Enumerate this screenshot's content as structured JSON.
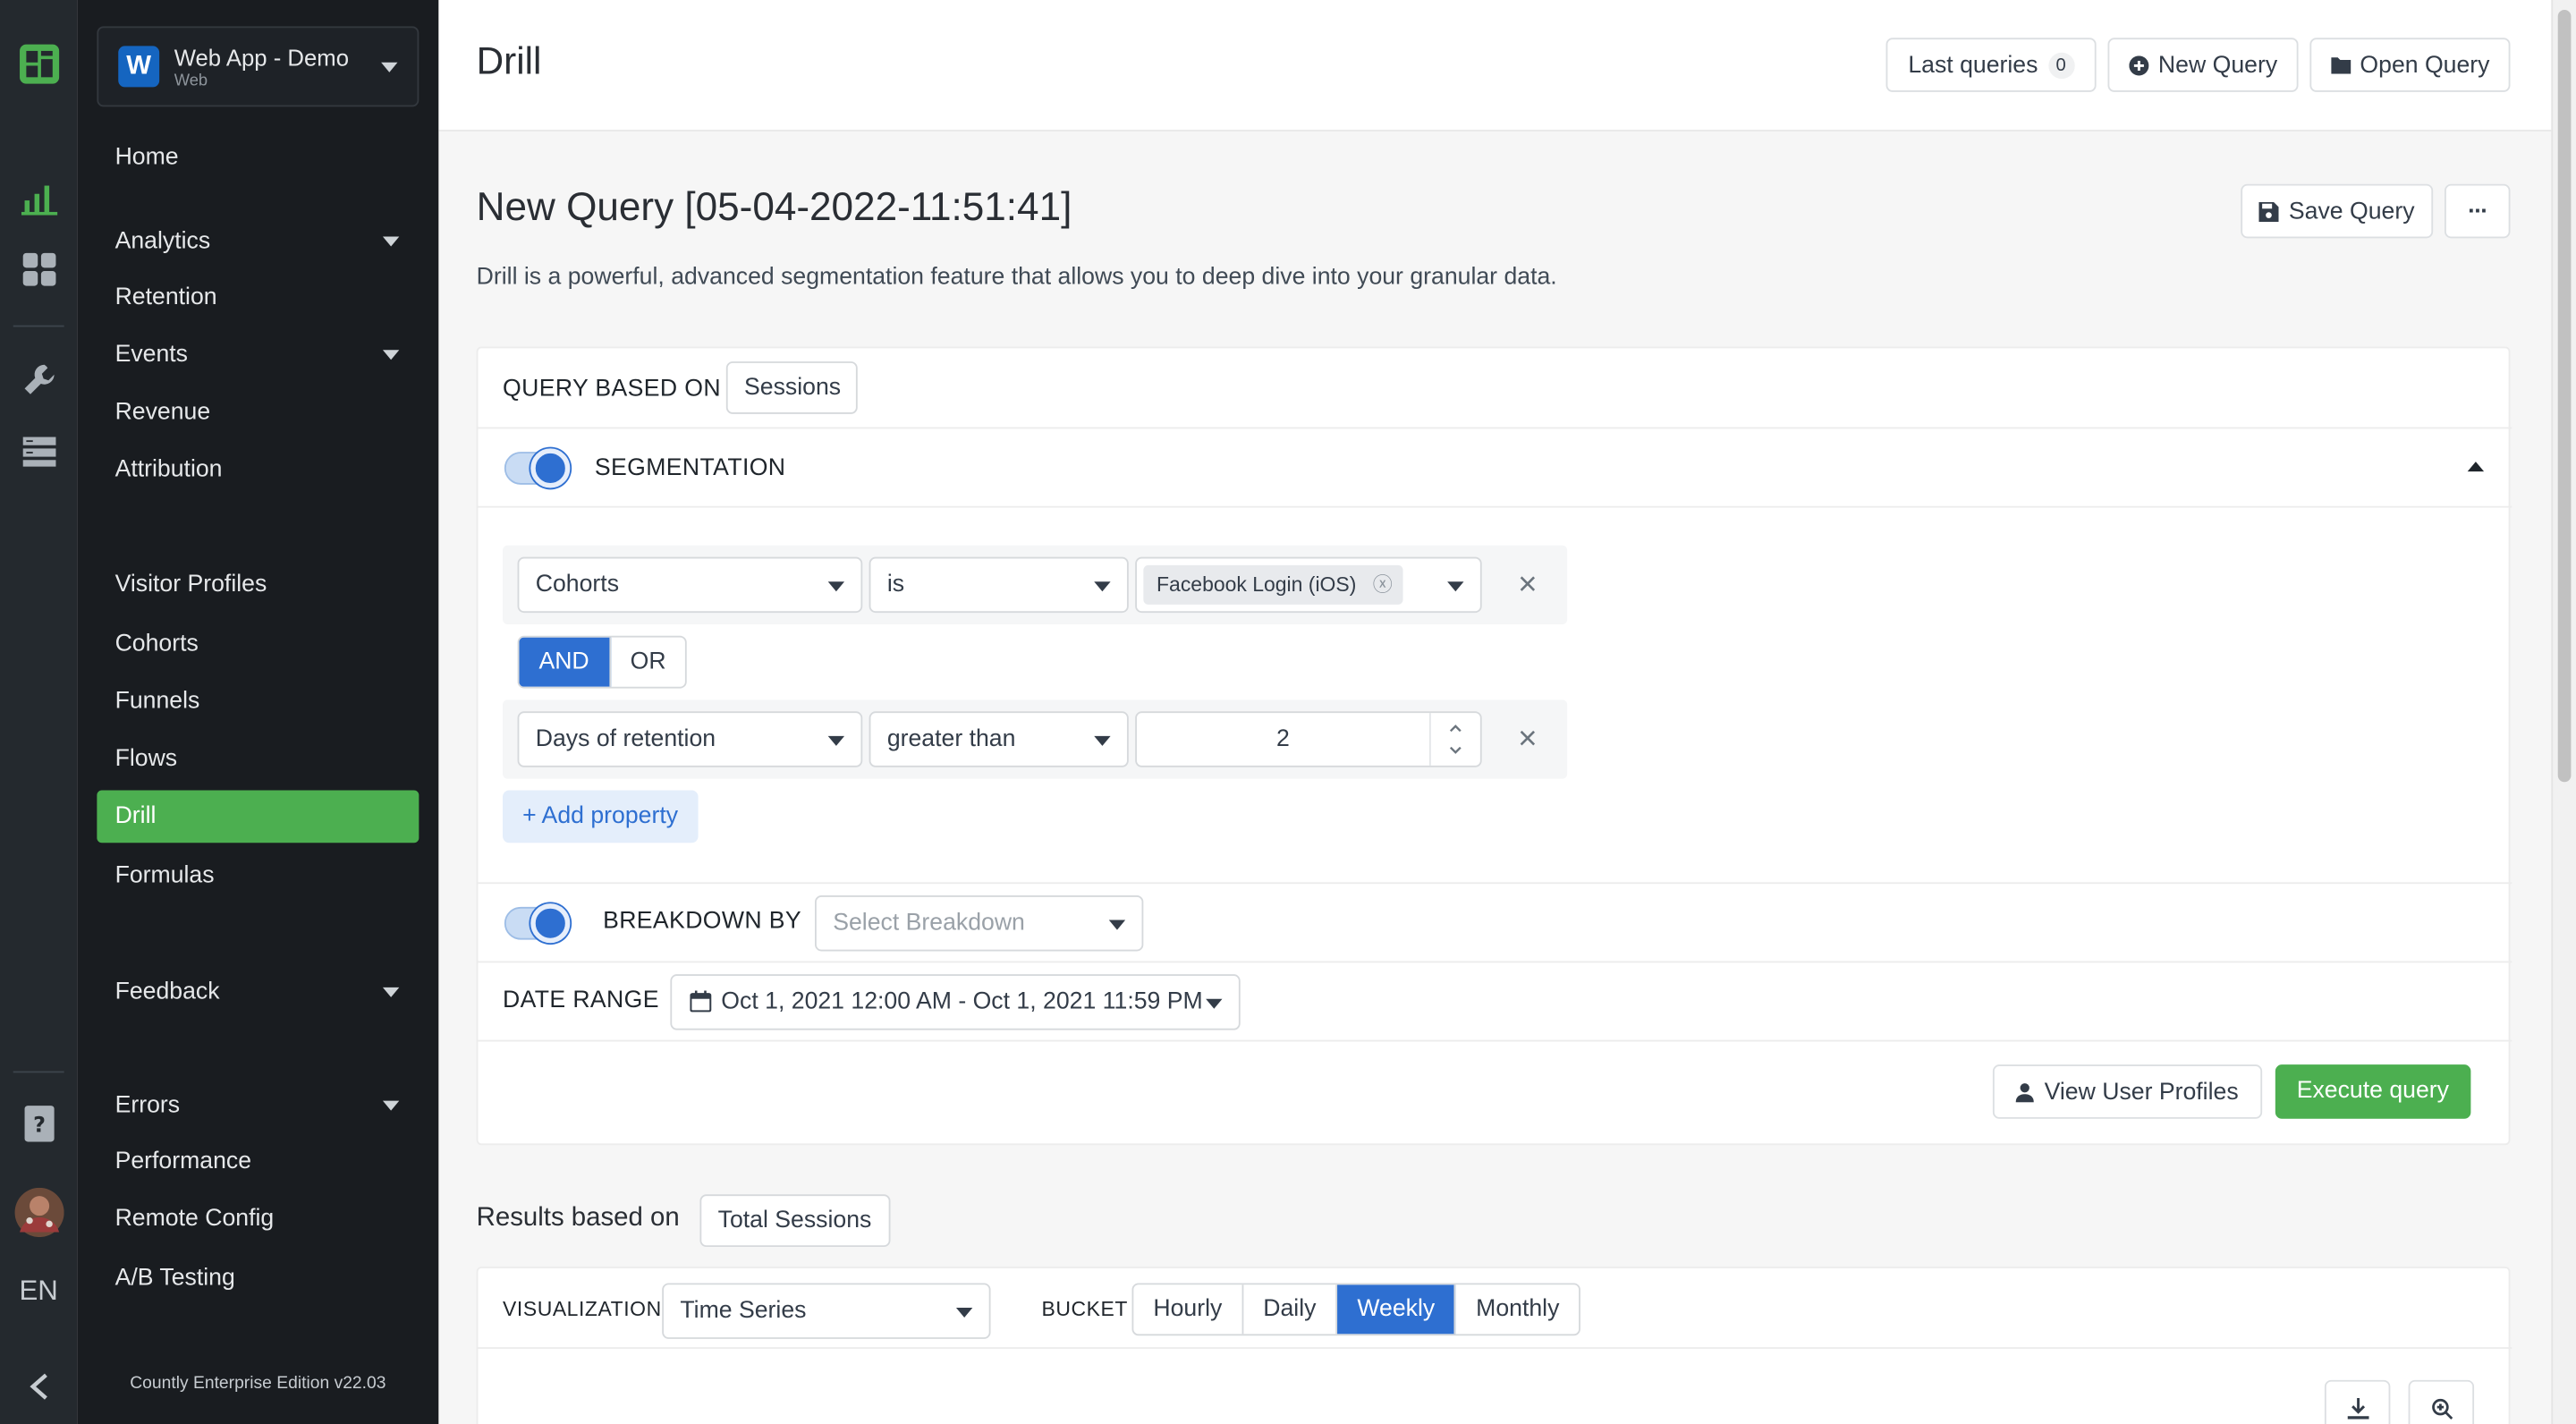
{
  "app": {
    "badge_letter": "W",
    "name": "Web App - Demo",
    "type": "Web",
    "language": "EN",
    "edition": "Countly Enterprise Edition v22.03"
  },
  "rail_icons": [
    "countly-logo-icon",
    "analytics-chart-icon",
    "dashboards-grid-icon",
    "management-wrench-icon",
    "data-storage-icon",
    "help-book-icon",
    "user-avatar",
    "collapse-chevron-left-icon"
  ],
  "sidebar": {
    "items": [
      {
        "label": "Home"
      },
      {
        "label": "Analytics",
        "expandable": true
      },
      {
        "label": "Retention"
      },
      {
        "label": "Events",
        "expandable": true
      },
      {
        "label": "Revenue"
      },
      {
        "label": "Attribution"
      },
      {
        "label": "Visitor Profiles"
      },
      {
        "label": "Cohorts"
      },
      {
        "label": "Funnels"
      },
      {
        "label": "Flows"
      },
      {
        "label": "Drill",
        "active": true
      },
      {
        "label": "Formulas"
      },
      {
        "label": "Feedback",
        "expandable": true
      },
      {
        "label": "Errors",
        "expandable": true
      },
      {
        "label": "Performance"
      },
      {
        "label": "Remote Config"
      },
      {
        "label": "A/B Testing"
      }
    ]
  },
  "header": {
    "title": "Drill",
    "last_queries_label": "Last queries",
    "last_queries_count": "0",
    "new_query_label": "New Query",
    "open_query_label": "Open Query"
  },
  "query": {
    "title": "New Query [05-04-2022-11:51:41]",
    "description": "Drill is a powerful, advanced segmentation feature that allows you to deep dive into your granular data.",
    "save_label": "Save Query",
    "more_label": "···",
    "based_on_label": "QUERY BASED ON",
    "based_on_value": "Sessions",
    "segmentation_label": "SEGMENTATION",
    "segmentation_enabled": true,
    "filters": [
      {
        "property": "Cohorts",
        "operator": "is",
        "value_tag": "Facebook Login (iOS)"
      },
      {
        "property": "Days of retention",
        "operator": "greater than",
        "value": "2"
      }
    ],
    "logic_options": [
      "AND",
      "OR"
    ],
    "logic_selected": "AND",
    "add_property_label": "+ Add property",
    "breakdown_label": "BREAKDOWN BY",
    "breakdown_enabled": true,
    "breakdown_placeholder": "Select Breakdown",
    "date_range_label": "DATE RANGE",
    "date_range_value": "Oct 1, 2021 12:00 AM - Oct 1, 2021 11:59 PM",
    "view_profiles_label": "View User Profiles",
    "execute_label": "Execute query"
  },
  "results": {
    "label": "Results based on",
    "metric": "Total Sessions",
    "visualization_label": "VISUALIZATION",
    "visualization_value": "Time Series",
    "bucket_label": "BUCKET",
    "bucket_options": [
      "Hourly",
      "Daily",
      "Weekly",
      "Monthly"
    ],
    "bucket_selected": "Weekly"
  },
  "colors": {
    "sidebar_bg": "#191c20",
    "rail_bg": "#24292e",
    "accent_green": "#4caf50",
    "accent_blue": "#2e6fd1"
  }
}
